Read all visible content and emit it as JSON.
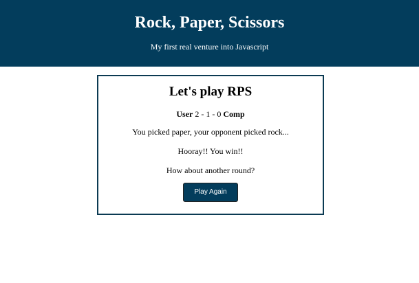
{
  "header": {
    "title": "Rock, Paper, Scissors",
    "subtitle": "My first real venture into Javascript"
  },
  "game": {
    "heading": "Let's play RPS",
    "score": {
      "user_label": "User",
      "user_score": "2",
      "separator1": " - ",
      "ties": "1",
      "separator2": " - ",
      "comp_score": "0",
      "comp_label": "Comp"
    },
    "result_text": "You picked paper, your opponent picked rock...",
    "outcome_text": "Hooray!! You win!!",
    "prompt_text": "How about another round?",
    "play_again_label": "Play Again"
  },
  "colors": {
    "header_bg": "#033d5c",
    "box_border": "#0b3a52",
    "button_bg": "#033d5c"
  }
}
